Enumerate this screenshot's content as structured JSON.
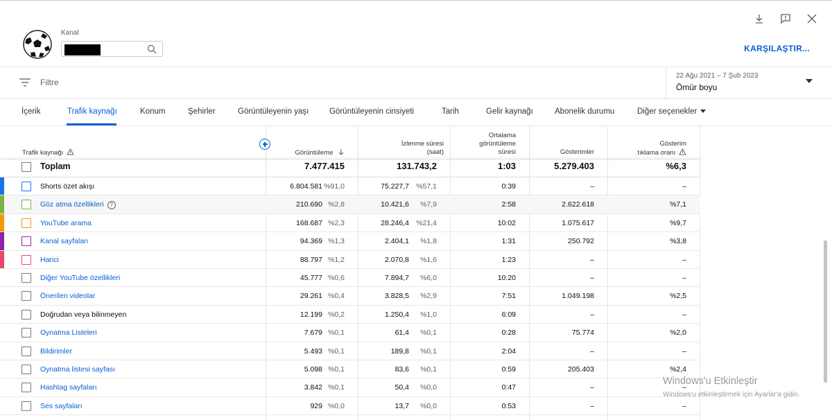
{
  "header": {
    "channel_label": "Kanal",
    "compare_label": "KARŞILAŞTIR..."
  },
  "filter": {
    "placeholder": "Filtre"
  },
  "date": {
    "range": "22 Ağu 2021 – 7 Şub 2023",
    "value": "Ömür boyu"
  },
  "tabs": [
    {
      "label": "İçerik"
    },
    {
      "label": "Trafik kaynağı"
    },
    {
      "label": "Konum"
    },
    {
      "label": "Şehirler"
    },
    {
      "label": "Görüntüleyenin yaşı"
    },
    {
      "label": "Görüntüleyenin cinsiyeti"
    },
    {
      "label": "Tarih"
    },
    {
      "label": "Gelir kaynağı"
    },
    {
      "label": "Abonelik durumu"
    },
    {
      "label": "Diğer seçenekler"
    }
  ],
  "columns": {
    "source": "Trafik kaynağı",
    "views": "Görüntüleme",
    "watch_l1": "İzlenme süresi",
    "watch_l2": "(saat)",
    "avg_l1": "Ortalama",
    "avg_l2": "görüntüleme",
    "avg_l3": "süresi",
    "impr": "Gösterimler",
    "ctr_l1": "Gösterim",
    "ctr_l2": "tıklama oranı"
  },
  "total": {
    "label": "Toplam",
    "views": "7.477.415",
    "watch": "131.743,2",
    "avg": "1:03",
    "impr": "5.279.403",
    "ctr": "%6,3"
  },
  "rows": [
    {
      "name": "Shorts özet akışı",
      "views": "6.804.581",
      "views_pct": "%91,0",
      "watch": "75.227,7",
      "watch_pct": "%57,1",
      "avg": "0:39",
      "impr": "–",
      "ctr": "–"
    },
    {
      "name": "Göz atma özellikleri",
      "views": "210.690",
      "views_pct": "%2,8",
      "watch": "10.421,6",
      "watch_pct": "%7,9",
      "avg": "2:58",
      "impr": "2.622.618",
      "ctr": "%7,1"
    },
    {
      "name": "YouTube arama",
      "views": "168.687",
      "views_pct": "%2,3",
      "watch": "28.246,4",
      "watch_pct": "%21,4",
      "avg": "10:02",
      "impr": "1.075.617",
      "ctr": "%9,7"
    },
    {
      "name": "Kanal sayfaları",
      "views": "94.369",
      "views_pct": "%1,3",
      "watch": "2.404,1",
      "watch_pct": "%1,8",
      "avg": "1:31",
      "impr": "250.792",
      "ctr": "%3,8"
    },
    {
      "name": "Harici",
      "views": "88.797",
      "views_pct": "%1,2",
      "watch": "2.070,8",
      "watch_pct": "%1,6",
      "avg": "1:23",
      "impr": "–",
      "ctr": "–"
    },
    {
      "name": "Diğer YouTube özellikleri",
      "views": "45.777",
      "views_pct": "%0,6",
      "watch": "7.894,7",
      "watch_pct": "%6,0",
      "avg": "10:20",
      "impr": "–",
      "ctr": "–"
    },
    {
      "name": "Önerilen videolar",
      "views": "29.261",
      "views_pct": "%0,4",
      "watch": "3.828,5",
      "watch_pct": "%2,9",
      "avg": "7:51",
      "impr": "1.049.198",
      "ctr": "%2,5"
    },
    {
      "name": "Doğrudan veya bilinmeyen",
      "views": "12.199",
      "views_pct": "%0,2",
      "watch": "1.250,4",
      "watch_pct": "%1,0",
      "avg": "6:09",
      "impr": "–",
      "ctr": "–"
    },
    {
      "name": "Oynatma Listeleri",
      "views": "7.679",
      "views_pct": "%0,1",
      "watch": "61,4",
      "watch_pct": "%0,1",
      "avg": "0:28",
      "impr": "75.774",
      "ctr": "%2,0"
    },
    {
      "name": "Bildirimler",
      "views": "5.493",
      "views_pct": "%0,1",
      "watch": "189,8",
      "watch_pct": "%0,1",
      "avg": "2:04",
      "impr": "–",
      "ctr": "–"
    },
    {
      "name": "Oynatma listesi sayfası",
      "views": "5.098",
      "views_pct": "%0,1",
      "watch": "83,6",
      "watch_pct": "%0,1",
      "avg": "0:59",
      "impr": "205.403",
      "ctr": "%2,4"
    },
    {
      "name": "Hashtag sayfaları",
      "views": "3.842",
      "views_pct": "%0,1",
      "watch": "50,4",
      "watch_pct": "%0,0",
      "avg": "0:47",
      "impr": "–",
      "ctr": "–"
    },
    {
      "name": "Ses sayfaları",
      "views": "929",
      "views_pct": "%0,0",
      "watch": "13,7",
      "watch_pct": "%0,0",
      "avg": "0:53",
      "impr": "–",
      "ctr": "–"
    }
  ],
  "row_style": [
    {
      "color": "#1a73e8",
      "link": false
    },
    {
      "color": "#7cb342",
      "link": true,
      "help": "?"
    },
    {
      "color": "#f29900",
      "link": true
    },
    {
      "color": "#8e24aa",
      "link": true
    },
    {
      "color": "#e8486c",
      "link": true
    },
    {
      "color": "",
      "link": true
    },
    {
      "color": "",
      "link": true
    },
    {
      "color": "",
      "link": false
    },
    {
      "color": "",
      "link": true
    },
    {
      "color": "",
      "link": true
    },
    {
      "color": "",
      "link": true
    },
    {
      "color": "",
      "link": true
    },
    {
      "color": "",
      "link": true
    }
  ],
  "watermark": {
    "line1": "Windows'u Etkinleştir",
    "line2": "Windows'u etkinleştirmek için Ayarlar'a gidin."
  },
  "icons": [
    "download-icon",
    "feedback-icon",
    "close-icon",
    "search-icon",
    "filter-icon",
    "sort-down-icon",
    "warning-icon",
    "add-metric-icon",
    "help-icon",
    "dropdown-caret-icon"
  ]
}
